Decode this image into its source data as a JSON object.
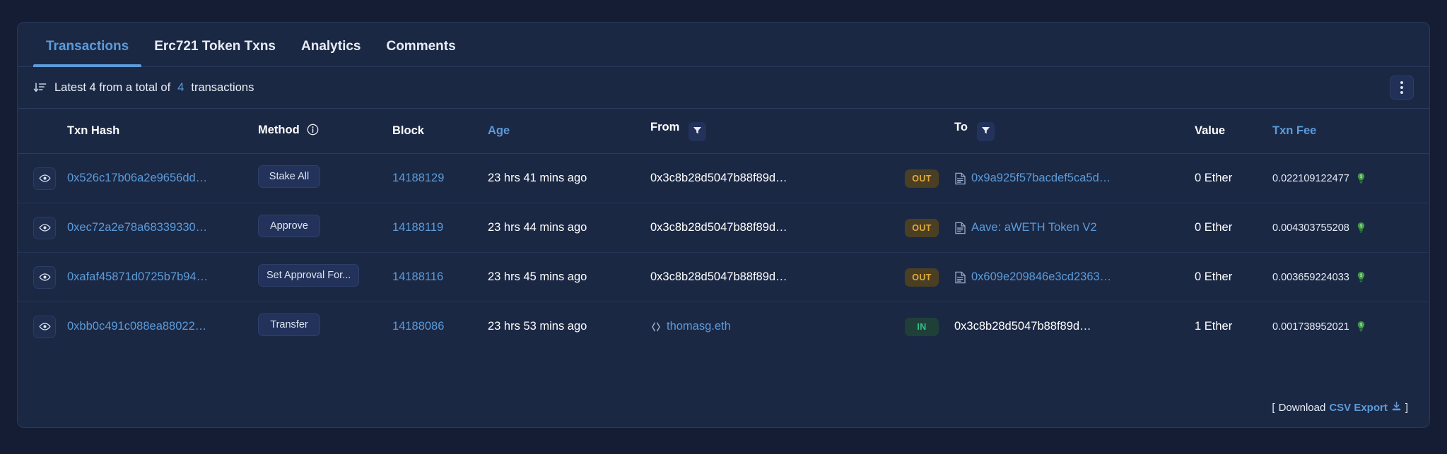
{
  "panel": {
    "tabs": [
      {
        "label": "Transactions",
        "active": true
      },
      {
        "label": "Erc721 Token Txns",
        "active": false
      },
      {
        "label": "Analytics",
        "active": false
      },
      {
        "label": "Comments",
        "active": false
      }
    ],
    "status": {
      "sort_icon": "sort-descending-icon",
      "prefix": "Latest 4 from a total of",
      "count": "4",
      "suffix": "transactions",
      "menu_icon": "kebab-menu-icon"
    },
    "table": {
      "headers": {
        "eye": "",
        "txn_hash": "Txn Hash",
        "method": "Method",
        "method_info_icon": "info-icon",
        "block": "Block",
        "age": "Age",
        "from": "From",
        "from_filter_icon": "filter-icon",
        "direction": "",
        "to": "To",
        "to_filter_icon": "filter-icon",
        "value": "Value",
        "txn_fee": "Txn Fee"
      },
      "rows": [
        {
          "eye_icon": "eye-icon",
          "txn_hash": "0x526c17b06a2e9656dd…",
          "method": "Stake All",
          "block": "14188129",
          "age": "23 hrs 41 mins ago",
          "from": "0x3c8b28d5047b88f89d…",
          "from_is_link": false,
          "from_icon": "",
          "direction": "OUT",
          "to": "0x9a925f57bacdef5ca5d…",
          "to_is_link": true,
          "to_icon": "contract-icon",
          "value": "0 Ether",
          "fee": "0.022109122477",
          "fee_icon": "gas-bulb-icon"
        },
        {
          "eye_icon": "eye-icon",
          "txn_hash": "0xec72a2e78a68339330…",
          "method": "Approve",
          "block": "14188119",
          "age": "23 hrs 44 mins ago",
          "from": "0x3c8b28d5047b88f89d…",
          "from_is_link": false,
          "from_icon": "",
          "direction": "OUT",
          "to": "Aave: aWETH Token V2",
          "to_is_link": true,
          "to_icon": "contract-icon",
          "value": "0 Ether",
          "fee": "0.004303755208",
          "fee_icon": "gas-bulb-icon"
        },
        {
          "eye_icon": "eye-icon",
          "txn_hash": "0xafaf45871d0725b7b94…",
          "method": "Set Approval For...",
          "block": "14188116",
          "age": "23 hrs 45 mins ago",
          "from": "0x3c8b28d5047b88f89d…",
          "from_is_link": false,
          "from_icon": "",
          "direction": "OUT",
          "to": "0x609e209846e3cd2363…",
          "to_is_link": true,
          "to_icon": "contract-icon",
          "value": "0 Ether",
          "fee": "0.003659224033",
          "fee_icon": "gas-bulb-icon"
        },
        {
          "eye_icon": "eye-icon",
          "txn_hash": "0xbb0c491c088ea88022…",
          "method": "Transfer",
          "block": "14188086",
          "age": "23 hrs 53 mins ago",
          "from": "thomasg.eth",
          "from_is_link": true,
          "from_icon": "ens-brackets-icon",
          "direction": "IN",
          "to": "0x3c8b28d5047b88f89d…",
          "to_is_link": false,
          "to_icon": "",
          "value": "1 Ether",
          "fee": "0.001738952021",
          "fee_icon": "gas-bulb-icon"
        }
      ]
    },
    "footer": {
      "open_bracket": "[",
      "download_label": "Download",
      "csv_label": "CSV Export",
      "download_icon": "download-icon",
      "close_bracket": "]"
    }
  },
  "colors": {
    "page_bg": "#141d33",
    "panel_bg": "#1b2844",
    "accent_blue": "#5b9bd9",
    "out_badge": "#e0aa3e",
    "in_badge": "#34c08a"
  }
}
